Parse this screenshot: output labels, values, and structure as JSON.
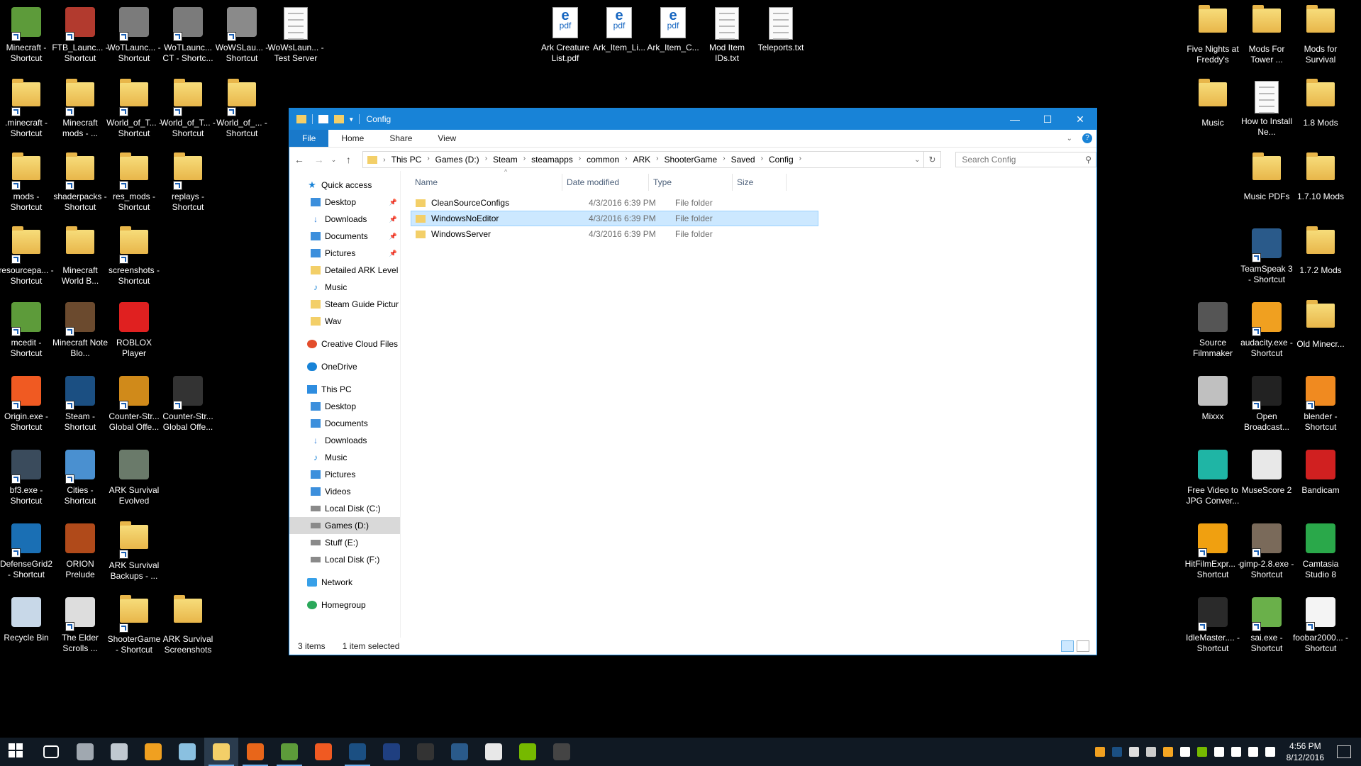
{
  "desktop": {
    "left_icons": [
      {
        "label": "Minecraft - Shortcut",
        "kind": "app",
        "color": "#5d9b3a",
        "shortcut": true
      },
      {
        "label": "FTB_Launc... - Shortcut",
        "kind": "app",
        "color": "#b23a2e",
        "shortcut": true
      },
      {
        "label": "WoTLaunc... - Shortcut",
        "kind": "app",
        "color": "#7b7b7b",
        "shortcut": true
      },
      {
        "label": "WoTLaunc... CT - Shortc...",
        "kind": "app",
        "color": "#7b7b7b",
        "shortcut": true
      },
      {
        "label": "WoWSLau... - Shortcut",
        "kind": "app",
        "color": "#8a8a8a",
        "shortcut": true
      },
      {
        "label": "WoWsLaun... - Test Server",
        "kind": "doc",
        "color": "#fafafa",
        "shortcut": false
      },
      {
        "label": ".minecraft - Shortcut",
        "kind": "folder",
        "shortcut": true
      },
      {
        "label": "Minecraft mods - ...",
        "kind": "folder",
        "shortcut": true
      },
      {
        "label": "World_of_T... - Shortcut",
        "kind": "folder",
        "shortcut": true
      },
      {
        "label": "World_of_T... - Shortcut",
        "kind": "folder",
        "shortcut": true
      },
      {
        "label": "World_of_... - Shortcut",
        "kind": "folder",
        "shortcut": true
      },
      {
        "label": "mods - Shortcut",
        "kind": "folder",
        "shortcut": true
      },
      {
        "label": "shaderpacks - Shortcut",
        "kind": "folder",
        "shortcut": true
      },
      {
        "label": "res_mods - Shortcut",
        "kind": "folder",
        "shortcut": true
      },
      {
        "label": "replays - Shortcut",
        "kind": "folder",
        "shortcut": true
      },
      {
        "label": "resourcepa... - Shortcut",
        "kind": "folder",
        "shortcut": true
      },
      {
        "label": "Minecraft World B...",
        "kind": "folder",
        "shortcut": false
      },
      {
        "label": "screenshots - Shortcut",
        "kind": "folder",
        "shortcut": true
      },
      {
        "label": "mcedit - Shortcut",
        "kind": "app",
        "color": "#5d9b3a",
        "shortcut": true
      },
      {
        "label": "Minecraft Note Blo...",
        "kind": "app",
        "color": "#6b4a2e",
        "shortcut": true
      },
      {
        "label": "ROBLOX Player",
        "kind": "app",
        "color": "#e02020",
        "shortcut": false
      },
      {
        "label": "Origin.exe - Shortcut",
        "kind": "app",
        "color": "#f05a22",
        "shortcut": true
      },
      {
        "label": "Steam - Shortcut",
        "kind": "app",
        "color": "#1b4f82",
        "shortcut": true
      },
      {
        "label": "Counter-Str... Global Offe...",
        "kind": "app",
        "color": "#d08a1a",
        "shortcut": true
      },
      {
        "label": "Counter-Str... Global Offe...",
        "kind": "app",
        "color": "#333333",
        "shortcut": true
      },
      {
        "label": "bf3.exe - Shortcut",
        "kind": "app",
        "color": "#3a4b5c",
        "shortcut": true
      },
      {
        "label": "Cities - Shortcut",
        "kind": "app",
        "color": "#4a90d0",
        "shortcut": true
      },
      {
        "label": "ARK Survival Evolved",
        "kind": "app",
        "color": "#6a7a6a",
        "shortcut": false
      },
      {
        "label": "DefenseGrid2 - Shortcut",
        "kind": "app",
        "color": "#1a6fb4",
        "shortcut": true
      },
      {
        "label": "ORION Prelude",
        "kind": "app",
        "color": "#b04a1a",
        "shortcut": false
      },
      {
        "label": "ARK Survival Backups - ...",
        "kind": "folder",
        "shortcut": true
      },
      {
        "label": "Recycle Bin",
        "kind": "app",
        "color": "#c8d8e8",
        "shortcut": false
      },
      {
        "label": "The Elder Scrolls ...",
        "kind": "app",
        "color": "#dddddd",
        "shortcut": true
      },
      {
        "label": "ShooterGame - Shortcut",
        "kind": "folder",
        "shortcut": true
      },
      {
        "label": "ARK Survival Screenshots",
        "kind": "folder",
        "shortcut": false
      }
    ],
    "center_icons": [
      {
        "label": "Ark Creature List.pdf",
        "kind": "pdf"
      },
      {
        "label": "Ark_Item_Li...",
        "kind": "pdf"
      },
      {
        "label": "Ark_Item_C...",
        "kind": "pdf"
      },
      {
        "label": "Mod Item IDs.txt",
        "kind": "doc"
      },
      {
        "label": "Teleports.txt",
        "kind": "doc"
      }
    ],
    "right_icons": [
      {
        "label": "Five Nights at Freddy's",
        "kind": "folder",
        "shortcut": false
      },
      {
        "label": "Mods For Tower ...",
        "kind": "folder",
        "shortcut": false
      },
      {
        "label": "Mods for Survival",
        "kind": "folder",
        "shortcut": false
      },
      {
        "label": "Music",
        "kind": "folder",
        "shortcut": false
      },
      {
        "label": "How to Install Ne...",
        "kind": "doc",
        "shortcut": false
      },
      {
        "label": "1.8 Mods",
        "kind": "folder",
        "shortcut": false
      },
      {
        "label": "Music PDFs",
        "kind": "folder",
        "shortcut": false
      },
      {
        "label": "1.7.10 Mods",
        "kind": "folder",
        "shortcut": false
      },
      {
        "label": "TeamSpeak 3 - Shortcut",
        "kind": "app",
        "color": "#2a5a8a",
        "shortcut": true
      },
      {
        "label": "1.7.2 Mods",
        "kind": "folder",
        "shortcut": false
      },
      {
        "label": "Source Filmmaker",
        "kind": "app",
        "color": "#555555",
        "shortcut": false
      },
      {
        "label": "audacity.exe - Shortcut",
        "kind": "app",
        "color": "#f0a020",
        "shortcut": true
      },
      {
        "label": "Old Minecr...",
        "kind": "folder",
        "shortcut": false
      },
      {
        "label": "Mixxx",
        "kind": "app",
        "color": "#c0c0c0",
        "shortcut": false
      },
      {
        "label": "Open Broadcast...",
        "kind": "app",
        "color": "#222222",
        "shortcut": true
      },
      {
        "label": "blender - Shortcut",
        "kind": "app",
        "color": "#f08a20",
        "shortcut": true
      },
      {
        "label": "Free Video to JPG Conver...",
        "kind": "app",
        "color": "#1fb5a5",
        "shortcut": false
      },
      {
        "label": "MuseScore 2",
        "kind": "app",
        "color": "#e8e8e8",
        "shortcut": false
      },
      {
        "label": "Bandicam",
        "kind": "app",
        "color": "#d02020",
        "shortcut": false
      },
      {
        "label": "HitFilmExpr... - Shortcut",
        "kind": "app",
        "color": "#f0a010",
        "shortcut": true
      },
      {
        "label": "gimp-2.8.exe - Shortcut",
        "kind": "app",
        "color": "#7a6a5a",
        "shortcut": true
      },
      {
        "label": "Camtasia Studio 8",
        "kind": "app",
        "color": "#2aa84a",
        "shortcut": false
      },
      {
        "label": "IdleMaster.... - Shortcut",
        "kind": "app",
        "color": "#2a2a2a",
        "shortcut": true
      },
      {
        "label": "sai.exe - Shortcut",
        "kind": "app",
        "color": "#6ab04a",
        "shortcut": true
      },
      {
        "label": "foobar2000... - Shortcut",
        "kind": "app",
        "color": "#f4f4f4",
        "shortcut": true
      }
    ]
  },
  "window": {
    "title": "Config",
    "ribbon_tabs": [
      "File",
      "Home",
      "Share",
      "View"
    ],
    "help": "?",
    "breadcrumbs": [
      "This PC",
      "Games (D:)",
      "Steam",
      "steamapps",
      "common",
      "ARK",
      "ShooterGame",
      "Saved",
      "Config"
    ],
    "search_placeholder": "Search Config",
    "nav": [
      {
        "label": "Quick access",
        "level": 1,
        "icon": "star-icon"
      },
      {
        "label": "Desktop",
        "level": 2,
        "icon": "desktop-icon",
        "pinned": true
      },
      {
        "label": "Downloads",
        "level": 2,
        "icon": "download-icon",
        "pinned": true
      },
      {
        "label": "Documents",
        "level": 2,
        "icon": "documents-icon",
        "pinned": true
      },
      {
        "label": "Pictures",
        "level": 2,
        "icon": "pictures-icon",
        "pinned": true
      },
      {
        "label": "Detailed ARK Level (",
        "level": 2,
        "icon": "folder-icon"
      },
      {
        "label": "Music",
        "level": 2,
        "icon": "music-icon"
      },
      {
        "label": "Steam Guide Pictur",
        "level": 2,
        "icon": "folder-icon"
      },
      {
        "label": "Wav",
        "level": 2,
        "icon": "folder-icon"
      },
      {
        "gap": true
      },
      {
        "label": "Creative Cloud Files",
        "level": 1,
        "icon": "creative-cloud-icon"
      },
      {
        "gap": true
      },
      {
        "label": "OneDrive",
        "level": 1,
        "icon": "onedrive-icon"
      },
      {
        "gap": true
      },
      {
        "label": "This PC",
        "level": 1,
        "icon": "pc-icon"
      },
      {
        "label": "Desktop",
        "level": 2,
        "icon": "desktop-icon"
      },
      {
        "label": "Documents",
        "level": 2,
        "icon": "documents-icon"
      },
      {
        "label": "Downloads",
        "level": 2,
        "icon": "download-icon"
      },
      {
        "label": "Music",
        "level": 2,
        "icon": "music-icon"
      },
      {
        "label": "Pictures",
        "level": 2,
        "icon": "pictures-icon"
      },
      {
        "label": "Videos",
        "level": 2,
        "icon": "videos-icon"
      },
      {
        "label": "Local Disk (C:)",
        "level": 2,
        "icon": "drive-icon"
      },
      {
        "label": "Games (D:)",
        "level": 2,
        "icon": "drive-icon",
        "selected": true
      },
      {
        "label": "Stuff (E:)",
        "level": 2,
        "icon": "drive-icon"
      },
      {
        "label": "Local Disk (F:)",
        "level": 2,
        "icon": "drive-icon"
      },
      {
        "gap": true
      },
      {
        "label": "Network",
        "level": 1,
        "icon": "network-icon"
      },
      {
        "gap": true
      },
      {
        "label": "Homegroup",
        "level": 1,
        "icon": "homegroup-icon"
      }
    ],
    "columns": {
      "name": "Name",
      "date": "Date modified",
      "type": "Type",
      "size": "Size"
    },
    "files": [
      {
        "name": "CleanSourceConfigs",
        "date": "4/3/2016 6:39 PM",
        "type": "File folder",
        "selected": false
      },
      {
        "name": "WindowsNoEditor",
        "date": "4/3/2016 6:39 PM",
        "type": "File folder",
        "selected": true
      },
      {
        "name": "WindowsServer",
        "date": "4/3/2016 6:39 PM",
        "type": "File folder",
        "selected": false
      }
    ],
    "status_items": "3 items",
    "status_selected": "1 item selected"
  },
  "taskbar": {
    "apps": [
      {
        "name": "start-button",
        "color": "#ffffff"
      },
      {
        "name": "task-view-button",
        "color": "#ffffff"
      },
      {
        "name": "taskbar-app-1",
        "color": "#a0a8b0"
      },
      {
        "name": "taskbar-app-2",
        "color": "#c0c8d0"
      },
      {
        "name": "taskbar-app-3",
        "color": "#f0a020"
      },
      {
        "name": "taskbar-app-4",
        "color": "#8ac0e0"
      },
      {
        "name": "taskbar-file-explorer",
        "color": "#f3cf68",
        "active": true
      },
      {
        "name": "taskbar-firefox",
        "color": "#e8661a",
        "open": true
      },
      {
        "name": "taskbar-minecraft",
        "color": "#5d9b3a",
        "open": true
      },
      {
        "name": "taskbar-origin",
        "color": "#f05a22"
      },
      {
        "name": "taskbar-steam",
        "color": "#1b4f82",
        "open": true
      },
      {
        "name": "taskbar-photoshop",
        "color": "#1f3f80"
      },
      {
        "name": "taskbar-obs",
        "color": "#333333"
      },
      {
        "name": "taskbar-teamspeak",
        "color": "#2a5a8a"
      },
      {
        "name": "taskbar-musescore",
        "color": "#e8e8e8"
      },
      {
        "name": "taskbar-nvidia",
        "color": "#76b900"
      },
      {
        "name": "taskbar-idlemaster",
        "color": "#444444"
      }
    ],
    "tray_colors": [
      "#f0a020",
      "#1b4f82",
      "#dddddd",
      "#cccccc",
      "#f5a623",
      "#ffffff",
      "#76b900",
      "#ffffff",
      "#ffffff",
      "#ffffff",
      "#ffffff"
    ],
    "time": "4:56 PM",
    "date": "8/12/2016"
  }
}
